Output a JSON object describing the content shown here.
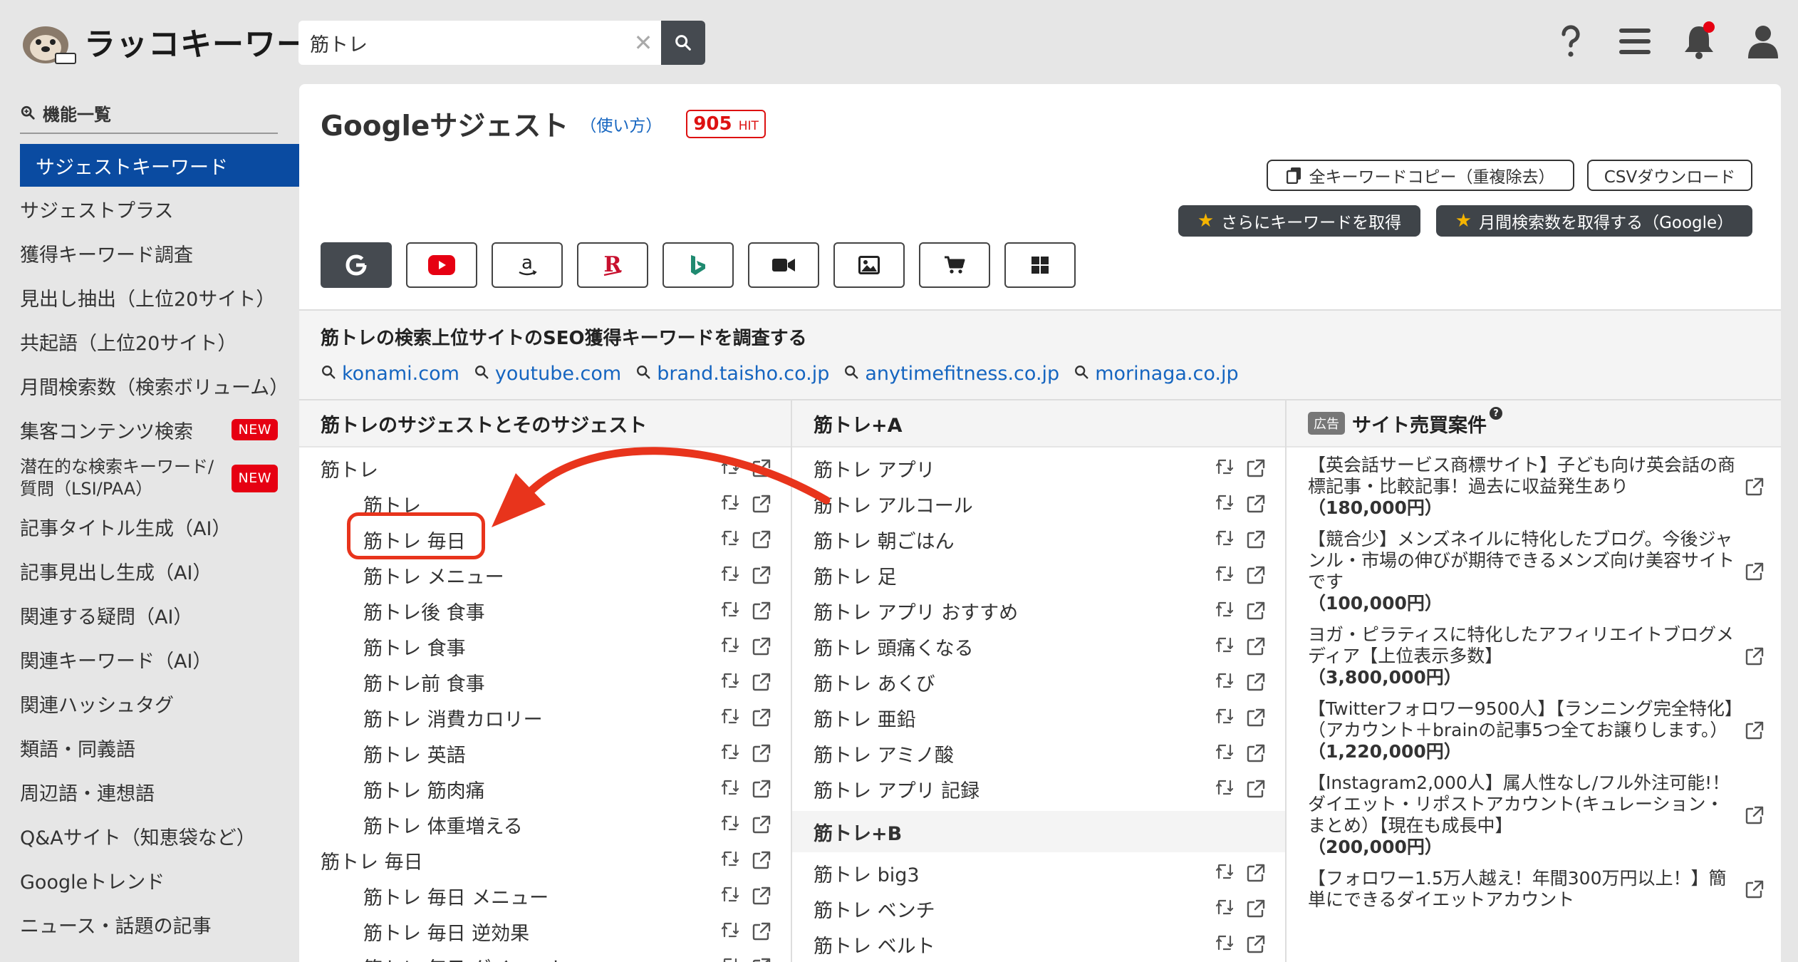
{
  "header": {
    "logo_text": "ラッコキーワード",
    "search_value": "筋トレ",
    "icons": [
      "help-icon",
      "menu-icon",
      "bell-icon",
      "user-icon"
    ]
  },
  "sidebar": {
    "heading": "機能一覧",
    "items": [
      {
        "label": "サジェストキーワード",
        "active": true
      },
      {
        "label": "サジェストプラス"
      },
      {
        "label": "獲得キーワード調査"
      },
      {
        "label": "見出し抽出（上位20サイト）"
      },
      {
        "label": "共起語（上位20サイト）"
      },
      {
        "label": "月間検索数（検索ボリューム）"
      },
      {
        "label": "集客コンテンツ検索",
        "badge": "NEW"
      },
      {
        "label": "潜在的な検索キーワード/\n質問（LSI/PAA）",
        "badge": "NEW"
      },
      {
        "label": "記事タイトル生成（AI）"
      },
      {
        "label": "記事見出し生成（AI）"
      },
      {
        "label": "関連する疑問（AI）"
      },
      {
        "label": "関連キーワード（AI）"
      },
      {
        "label": "関連ハッシュタグ"
      },
      {
        "label": "類語・同義語"
      },
      {
        "label": "周辺語・連想語"
      },
      {
        "label": "Q&Aサイト（知恵袋など）"
      },
      {
        "label": "Googleトレンド"
      },
      {
        "label": "ニュース・話題の記事"
      }
    ]
  },
  "main": {
    "title": "Googleサジェスト",
    "usage_link": "（使い方）",
    "hit_count": "905",
    "hit_label": "HIT",
    "copy_button": "全キーワードコピー（重複除去）",
    "csv_button": "CSVダウンロード",
    "more_keywords_button": "さらにキーワードを取得",
    "monthly_button": "月間検索数を取得する（Google）",
    "engines": [
      "google",
      "youtube",
      "amazon",
      "rakuten",
      "bing",
      "video",
      "image",
      "shopping",
      "apps"
    ],
    "seo_title": "筋トレの検索上位サイトのSEO獲得キーワードを調査する",
    "seo_links": [
      "konami.com",
      "youtube.com",
      "brand.taisho.co.jp",
      "anytimefitness.co.jp",
      "morinaga.co.jp"
    ]
  },
  "col1": {
    "heading": "筋トレのサジェストとそのサジェスト",
    "rows": [
      {
        "text": "筋トレ",
        "sub": false
      },
      {
        "text": "筋トレ",
        "sub": true
      },
      {
        "text": "筋トレ 毎日",
        "sub": true
      },
      {
        "text": "筋トレ メニュー",
        "sub": true
      },
      {
        "text": "筋トレ後 食事",
        "sub": true
      },
      {
        "text": "筋トレ 食事",
        "sub": true
      },
      {
        "text": "筋トレ前 食事",
        "sub": true
      },
      {
        "text": "筋トレ 消費カロリー",
        "sub": true
      },
      {
        "text": "筋トレ 英語",
        "sub": true
      },
      {
        "text": "筋トレ 筋肉痛",
        "sub": true
      },
      {
        "text": "筋トレ 体重増える",
        "sub": true
      },
      {
        "text": "筋トレ 毎日",
        "sub": false
      },
      {
        "text": "筋トレ 毎日 メニュー",
        "sub": true
      },
      {
        "text": "筋トレ 毎日 逆効果",
        "sub": true
      },
      {
        "text": "筋トレ 毎日 ダイエット",
        "sub": true
      }
    ]
  },
  "col2": {
    "heading": "筋トレ+A",
    "rows": [
      "筋トレ アプリ",
      "筋トレ アルコール",
      "筋トレ 朝ごはん",
      "筋トレ 足",
      "筋トレ アプリ おすすめ",
      "筋トレ 頭痛くなる",
      "筋トレ あくび",
      "筋トレ 亜鉛",
      "筋トレ アミノ酸",
      "筋トレ アプリ 記録"
    ],
    "heading_b": "筋トレ+B",
    "rows_b": [
      "筋トレ big3",
      "筋トレ ベンチ",
      "筋トレ ベルト"
    ]
  },
  "col3": {
    "ad_tag": "広告",
    "heading": "サイト売買案件",
    "help": "?",
    "ads": [
      {
        "text": "【英会話サービス商標サイト】子ども向け英会話の商標記事・比較記事！過去に収益発生あり",
        "price": "（180,000円）"
      },
      {
        "text": "【競合少】メンズネイルに特化したブログ。今後ジャンル・市場の伸びが期待できるメンズ向け美容サイトです",
        "price": "（100,000円）"
      },
      {
        "text": "ヨガ・ピラティスに特化したアフィリエイトブログメディア【上位表示多数】",
        "price": "（3,800,000円）"
      },
      {
        "text": "【Twitterフォロワー9500人】【ランニング完全特化】（アカウント＋brainの記事5つ全てお譲りします。）",
        "price": "（1,220,000円）"
      },
      {
        "text": "【Instagram2,000人】属人性なし/フル外注可能!！ダイエット・リポストアカウント(キュレーション・まとめ）【現在も成長中】",
        "price": "（200,000円）"
      },
      {
        "text": "【フォロワー1.5万人越え！年間300万円以上！】簡単にできるダイエットアカウント",
        "price": ""
      }
    ]
  }
}
